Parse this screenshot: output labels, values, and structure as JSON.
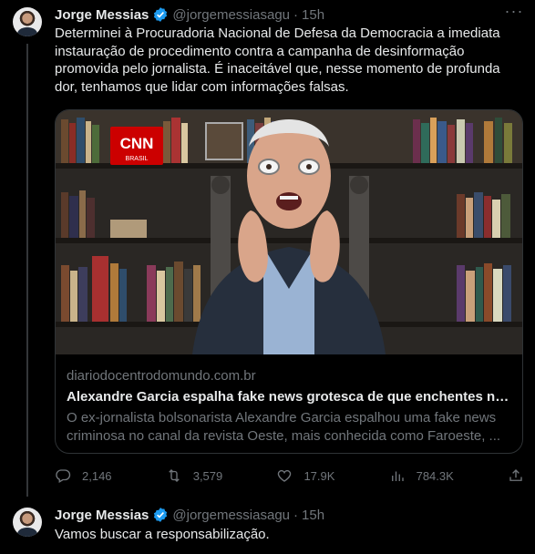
{
  "tweets": [
    {
      "author": "Jorge Messias",
      "handle": "@jorgemessiasagu",
      "separator": "·",
      "time": "15h",
      "text": "Determinei à Procuradoria Nacional de Defesa da Democracia a imediata instauração de procedimento contra a campanha de desinformação promovida pelo jornalista. É inaceitável que, nesse momento de profunda dor, tenhamos que lidar com informações falsas.",
      "card": {
        "image_brand": "CNN",
        "image_brand_sub": "BRASIL",
        "domain": "diariodocentrodomundo.com.br",
        "title": "Alexandre Garcia espalha fake news grotesca de que enchentes no RS",
        "description": "O ex-jornalista bolsonarista Alexandre Garcia espalhou uma fake news criminosa no canal da revista Oeste, mais conhecida como Faroeste, ..."
      },
      "actions": {
        "replies": "2,146",
        "reposts": "3,579",
        "likes": "17.9K",
        "views": "784.3K"
      }
    },
    {
      "author": "Jorge Messias",
      "handle": "@jorgemessiasagu",
      "separator": "·",
      "time": "15h",
      "text": "Vamos buscar a responsabilização."
    }
  ],
  "icons": {
    "verified": "verified-badge-icon",
    "more": "more-icon",
    "reply": "reply-icon",
    "repost": "repost-icon",
    "like": "heart-icon",
    "views": "analytics-icon",
    "share": "share-icon"
  },
  "colors": {
    "background": "#000000",
    "text_primary": "#e7e9ea",
    "text_secondary": "#71767b",
    "verified": "#1d9bf0",
    "border": "#2f3336",
    "cnn_red": "#cc0000"
  }
}
